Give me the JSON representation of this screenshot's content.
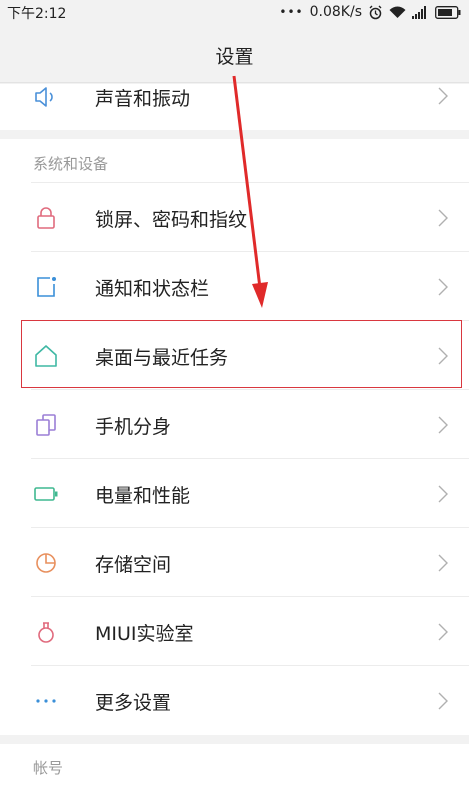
{
  "status_bar": {
    "time": "下午2:12",
    "dots": "•••",
    "network_speed": "0.08K/s",
    "icons": [
      "alarm-icon",
      "wifi-icon",
      "signal-icon",
      "battery-icon"
    ]
  },
  "header": {
    "title": "设置"
  },
  "top_item": {
    "label": "声音和振动",
    "icon": "speaker-icon"
  },
  "section_system": {
    "label": "系统和设备",
    "items": [
      {
        "label": "锁屏、密码和指纹",
        "icon": "lock-icon"
      },
      {
        "label": "通知和状态栏",
        "icon": "notification-icon"
      },
      {
        "label": "桌面与最近任务",
        "icon": "home-icon"
      },
      {
        "label": "手机分身",
        "icon": "dual-phone-icon"
      },
      {
        "label": "电量和性能",
        "icon": "battery-icon"
      },
      {
        "label": "存储空间",
        "icon": "storage-icon"
      },
      {
        "label": "MIUI实验室",
        "icon": "flask-icon"
      },
      {
        "label": "更多设置",
        "icon": "more-icon"
      }
    ]
  },
  "section_account": {
    "label": "帐号"
  },
  "colors": {
    "speaker": "#4a90d9",
    "lock": "#e06a7d",
    "notification": "#3a8fd8",
    "home": "#3fb8a4",
    "dual_phone": "#9b7fd6",
    "battery": "#3fb890",
    "storage": "#e8905e",
    "flask": "#e06a7d",
    "more": "#3a8fd8",
    "highlight": "#d9373f"
  }
}
